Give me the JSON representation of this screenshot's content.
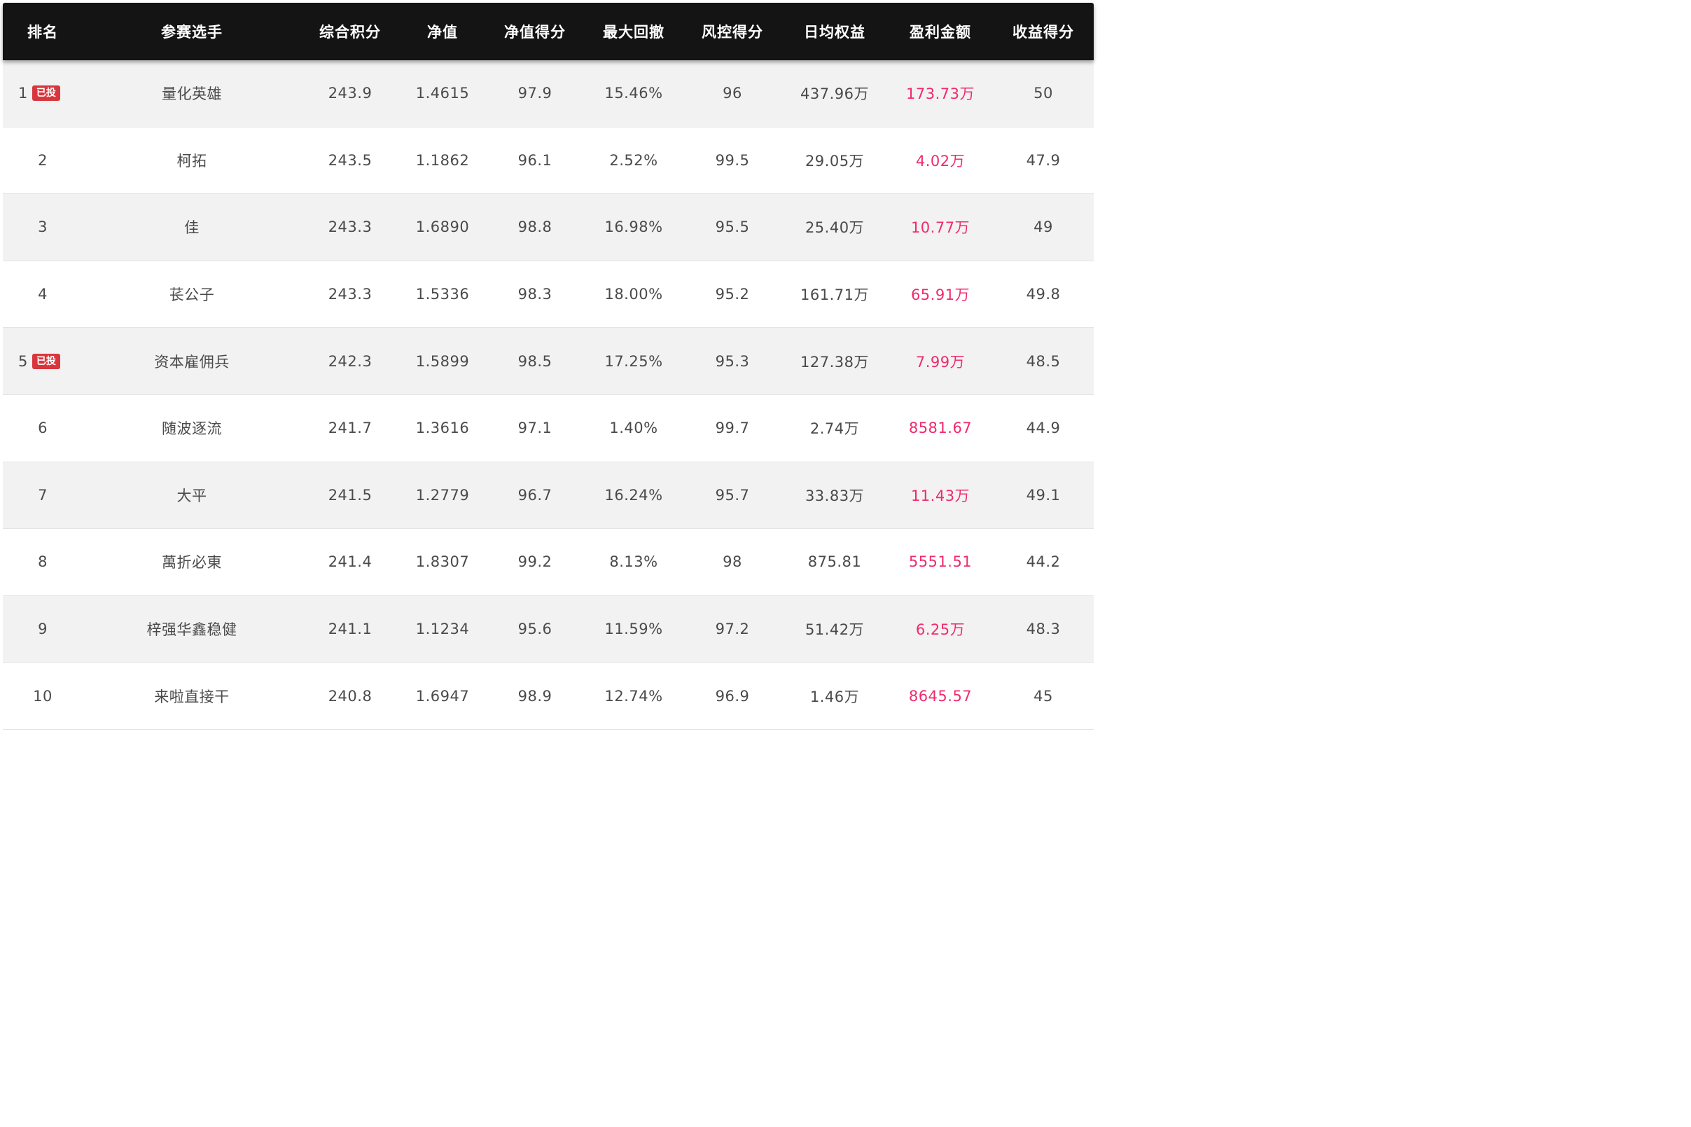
{
  "table": {
    "headers": [
      "排名",
      "参赛选手",
      "综合积分",
      "净值",
      "净值得分",
      "最大回撤",
      "风控得分",
      "日均权益",
      "盈利金额",
      "收益得分"
    ],
    "invested_badge": "已投",
    "rows": [
      {
        "rank": "1",
        "invested": true,
        "player": "量化英雄",
        "score": "243.9",
        "nav": "1.4615",
        "nav_score": "97.9",
        "max_drawdown": "15.46%",
        "risk_score": "96",
        "avg_equity": "437.96万",
        "profit": "173.73万",
        "return_score": "50"
      },
      {
        "rank": "2",
        "invested": false,
        "player": "柯拓",
        "score": "243.5",
        "nav": "1.1862",
        "nav_score": "96.1",
        "max_drawdown": "2.52%",
        "risk_score": "99.5",
        "avg_equity": "29.05万",
        "profit": "4.02万",
        "return_score": "47.9"
      },
      {
        "rank": "3",
        "invested": false,
        "player": "佳",
        "score": "243.3",
        "nav": "1.6890",
        "nav_score": "98.8",
        "max_drawdown": "16.98%",
        "risk_score": "95.5",
        "avg_equity": "25.40万",
        "profit": "10.77万",
        "return_score": "49"
      },
      {
        "rank": "4",
        "invested": false,
        "player": "苌公子",
        "score": "243.3",
        "nav": "1.5336",
        "nav_score": "98.3",
        "max_drawdown": "18.00%",
        "risk_score": "95.2",
        "avg_equity": "161.71万",
        "profit": "65.91万",
        "return_score": "49.8"
      },
      {
        "rank": "5",
        "invested": true,
        "player": "资本雇佣兵",
        "score": "242.3",
        "nav": "1.5899",
        "nav_score": "98.5",
        "max_drawdown": "17.25%",
        "risk_score": "95.3",
        "avg_equity": "127.38万",
        "profit": "7.99万",
        "return_score": "48.5"
      },
      {
        "rank": "6",
        "invested": false,
        "player": "随波逐流",
        "score": "241.7",
        "nav": "1.3616",
        "nav_score": "97.1",
        "max_drawdown": "1.40%",
        "risk_score": "99.7",
        "avg_equity": "2.74万",
        "profit": "8581.67",
        "return_score": "44.9"
      },
      {
        "rank": "7",
        "invested": false,
        "player": "大平",
        "score": "241.5",
        "nav": "1.2779",
        "nav_score": "96.7",
        "max_drawdown": "16.24%",
        "risk_score": "95.7",
        "avg_equity": "33.83万",
        "profit": "11.43万",
        "return_score": "49.1"
      },
      {
        "rank": "8",
        "invested": false,
        "player": "萬折必東",
        "score": "241.4",
        "nav": "1.8307",
        "nav_score": "99.2",
        "max_drawdown": "8.13%",
        "risk_score": "98",
        "avg_equity": "875.81",
        "profit": "5551.51",
        "return_score": "44.2"
      },
      {
        "rank": "9",
        "invested": false,
        "player": "梓强华鑫稳健",
        "score": "241.1",
        "nav": "1.1234",
        "nav_score": "95.6",
        "max_drawdown": "11.59%",
        "risk_score": "97.2",
        "avg_equity": "51.42万",
        "profit": "6.25万",
        "return_score": "48.3"
      },
      {
        "rank": "10",
        "invested": false,
        "player": "来啦直接干",
        "score": "240.8",
        "nav": "1.6947",
        "nav_score": "98.9",
        "max_drawdown": "12.74%",
        "risk_score": "96.9",
        "avg_equity": "1.46万",
        "profit": "8645.57",
        "return_score": "45"
      }
    ]
  },
  "colors": {
    "header_bg": "#141414",
    "header_text": "#ffffff",
    "row_alt_bg": "#f2f2f2",
    "text": "#4a4a4a",
    "profit_text": "#f02a6e",
    "badge_bg": "#d8363d"
  }
}
